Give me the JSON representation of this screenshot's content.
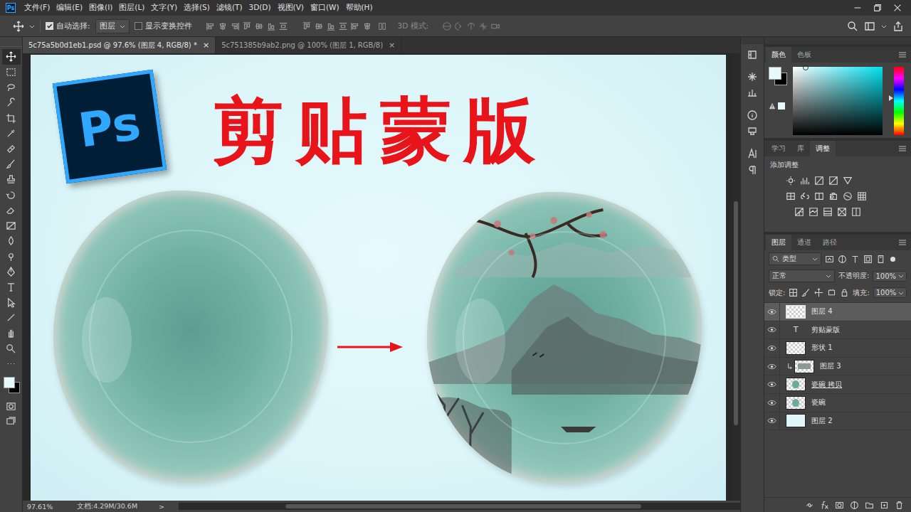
{
  "app": {
    "logo": "Ps"
  },
  "menu": [
    "文件(F)",
    "编辑(E)",
    "图像(I)",
    "图层(L)",
    "文字(Y)",
    "选择(S)",
    "滤镜(T)",
    "3D(D)",
    "视图(V)",
    "窗口(W)",
    "帮助(H)"
  ],
  "options_bar": {
    "auto_select": {
      "label": "自动选择:",
      "checked": true
    },
    "target": "图层",
    "show_transform": {
      "label": "显示变换控件",
      "checked": false
    },
    "mode_label": "3D 模式:"
  },
  "doc_tabs": [
    {
      "label": "5c75a5b0d1eb1.psd @ 97.6% (图层 4, RGB/8) *",
      "selected": true,
      "close": "×"
    },
    {
      "label": "5c751385b9ab2.png @ 100% (图层 1, RGB/8)",
      "selected": false,
      "close": "×"
    }
  ],
  "canvas": {
    "logo": "Ps",
    "title": "剪贴蒙版"
  },
  "status_bar": {
    "zoom": "97.61%",
    "doc": "文档:4.29M/30.6M",
    "more": ">"
  },
  "color_panel": {
    "tabs": [
      {
        "label": "颜色",
        "selected": true
      },
      {
        "label": "色板",
        "selected": false
      }
    ]
  },
  "adjust_panel": {
    "tabs": [
      {
        "label": "学习",
        "selected": false
      },
      {
        "label": "库",
        "selected": false
      },
      {
        "label": "调整",
        "selected": true
      }
    ],
    "label": "添加调整"
  },
  "layers_panel": {
    "tabs": [
      {
        "label": "图层",
        "selected": true
      },
      {
        "label": "通道",
        "selected": false
      },
      {
        "label": "路径",
        "selected": false
      }
    ],
    "filter": "类型",
    "blend": "正常",
    "opacity_label": "不透明度:",
    "opacity": "100%",
    "lock_label": "锁定:",
    "fill_label": "填充:",
    "fill": "100%",
    "text_glyph": "T",
    "layers": [
      {
        "name": "图层 4",
        "kind": "empty",
        "selected": true,
        "visible": true,
        "clipped": false,
        "clip_base": false
      },
      {
        "name": "剪贴蒙版",
        "kind": "text",
        "selected": false,
        "visible": true,
        "clipped": false,
        "clip_base": false
      },
      {
        "name": "形状 1",
        "kind": "empty",
        "selected": false,
        "visible": true,
        "clipped": false,
        "clip_base": false
      },
      {
        "name": "图层 3",
        "kind": "painting",
        "selected": false,
        "visible": true,
        "clipped": true,
        "clip_base": false
      },
      {
        "name": "瓷碗 拷贝",
        "kind": "bowl",
        "selected": false,
        "visible": true,
        "clipped": false,
        "clip_base": true
      },
      {
        "name": "瓷碗",
        "kind": "bowl",
        "selected": false,
        "visible": true,
        "clipped": false,
        "clip_base": false
      },
      {
        "name": "图层 2",
        "kind": "fill",
        "selected": false,
        "visible": true,
        "clipped": false,
        "clip_base": false
      }
    ]
  }
}
